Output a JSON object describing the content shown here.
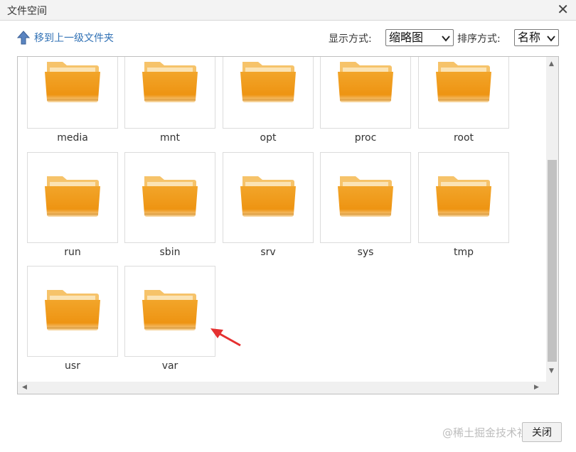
{
  "dialog": {
    "title": "文件空间",
    "close_icon": "close-icon"
  },
  "toolbar": {
    "up_label": "移到上一级文件夹",
    "display_label": "显示方式:",
    "display_value": "缩略图",
    "sort_label": "排序方式:",
    "sort_value": "名称"
  },
  "folders": [
    "media",
    "mnt",
    "opt",
    "proc",
    "root",
    "run",
    "sbin",
    "srv",
    "sys",
    "tmp",
    "usr",
    "var"
  ],
  "footer": {
    "close_label": "关闭",
    "watermark": "@稀土掘金技术社区"
  },
  "colors": {
    "link": "#3071b5",
    "folder_front": "#f0a020",
    "folder_back": "#f6c060",
    "annotation": "#e53030"
  }
}
